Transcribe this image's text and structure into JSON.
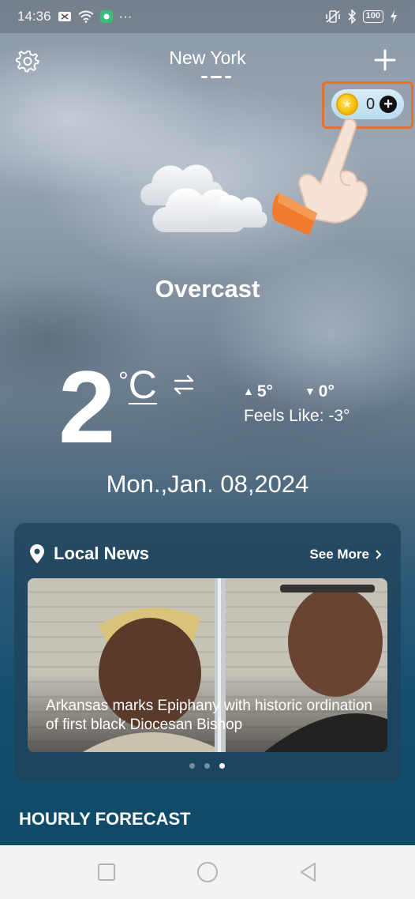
{
  "status_bar": {
    "time": "14:36",
    "more": "···",
    "battery": "100"
  },
  "header": {
    "city": "New York",
    "coins": {
      "count": "0",
      "add_symbol": "+"
    }
  },
  "current": {
    "condition": "Overcast",
    "temperature": "2",
    "unit_degree": "°",
    "unit_letter": "C",
    "high": "5°",
    "low": "0°",
    "feels_like": "Feels Like: -3°",
    "date": "Mon.,Jan. 08,2024"
  },
  "news": {
    "heading": "Local News",
    "see_more": "See More",
    "caption": "Arkansas marks Epiphany with historic ordination of first black Diocesan Bishop",
    "active_slide_index": 2,
    "slide_count": 3
  },
  "section": {
    "hourly_title": "HOURLY FORECAST"
  },
  "colors": {
    "accent_frame": "#e8702a",
    "coin_gold": "#f2b800",
    "card_bg": "#1e415a",
    "nav_bg": "#f3f3f3"
  },
  "icons": [
    "gear-icon",
    "plus-icon",
    "coin-icon",
    "hand-pointer-icon",
    "cloud-icon",
    "swap-units-icon",
    "location-pin-icon",
    "chevron-right-icon",
    "nav-square-icon",
    "nav-circle-icon",
    "nav-back-icon"
  ]
}
